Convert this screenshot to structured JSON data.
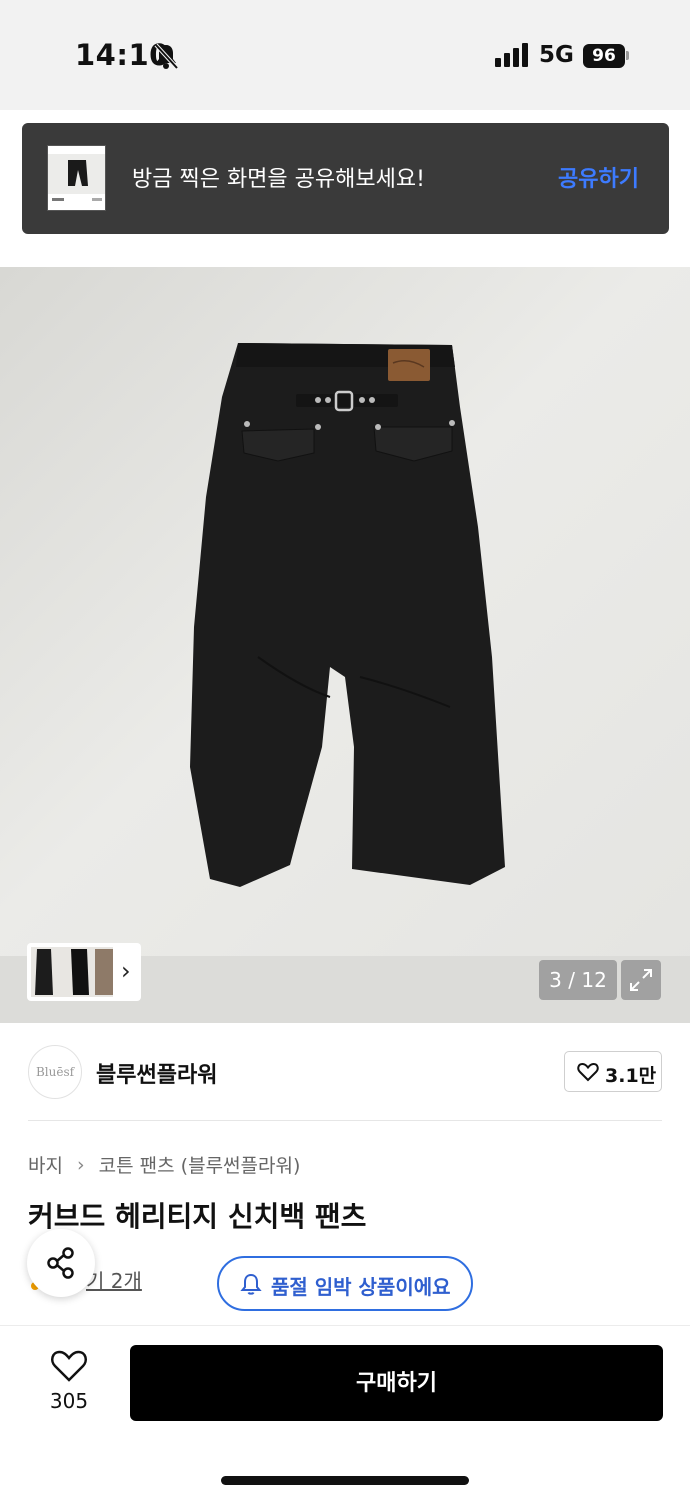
{
  "status_bar": {
    "time": "14:10",
    "network": "5G",
    "battery": "96",
    "icons": [
      "bell-slash-icon",
      "signal-icon",
      "battery-icon"
    ]
  },
  "toast": {
    "message": "방금 찍은 화면을 공유해보세요!",
    "action_label": "공유하기",
    "action_color": "#3d7bff"
  },
  "gallery": {
    "counter": "3 / 12",
    "icons": [
      "chevron-right-icon",
      "expand-icon"
    ]
  },
  "brand": {
    "logo_text": "Bluēsf",
    "name": "블루썬플라워",
    "like_count": "3.1만"
  },
  "product": {
    "breadcrumb": [
      "바지",
      "코튼 팬츠 (블루썬플라워)"
    ],
    "title": "커브드 헤리티지 신치백 팬츠",
    "review_link": "기 2개",
    "badge": "품절 임박 상품이에요",
    "badge_color": "#2f6ee0"
  },
  "bottom_bar": {
    "wish_count": "305",
    "buy_label": "구매하기"
  }
}
